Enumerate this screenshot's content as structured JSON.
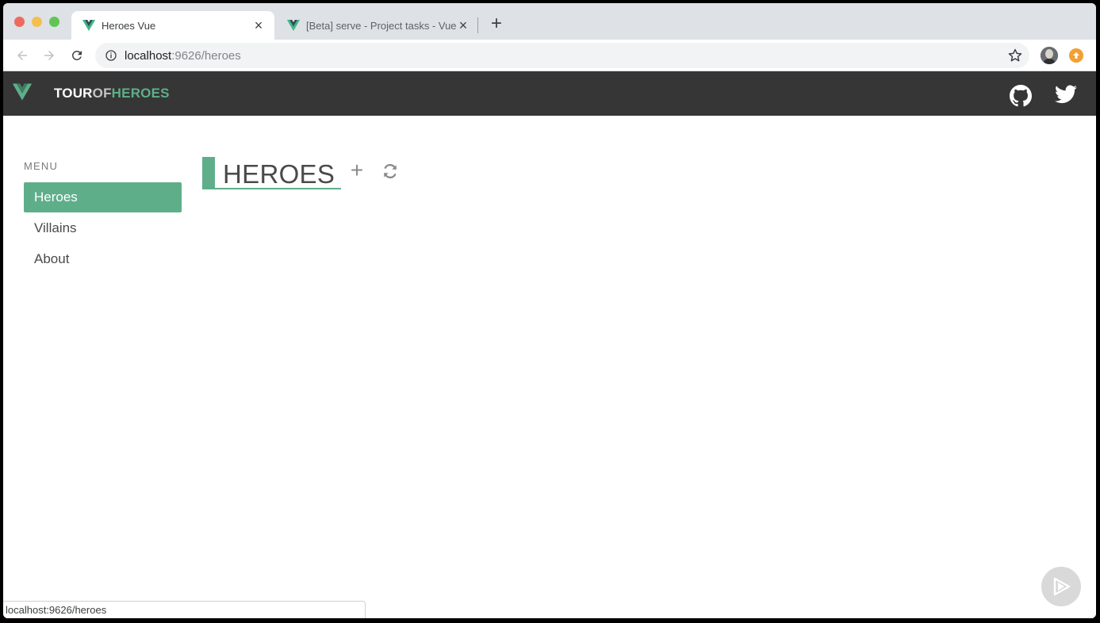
{
  "browser": {
    "tabs": [
      {
        "title": "Heroes Vue",
        "active": true
      },
      {
        "title": "[Beta] serve - Project tasks - Vue",
        "active": false
      }
    ],
    "new_tab_label": "+",
    "close_label": "×",
    "url": {
      "host": "localhost",
      "rest": ":9626/heroes"
    },
    "status_url": "localhost:9626/heroes"
  },
  "app": {
    "brand": {
      "part1": "TOUR",
      "part2": "OF",
      "part3": "HEROES"
    },
    "menu_label": "MENU",
    "menu_items": [
      {
        "label": "Heroes",
        "active": true
      },
      {
        "label": "Villains",
        "active": false
      },
      {
        "label": "About",
        "active": false
      }
    ],
    "page_title": "HEROES",
    "add_label": "+"
  },
  "colors": {
    "accent": "#5fae8a",
    "header_bg": "#363636",
    "text": "#4a4a4a"
  },
  "icons": [
    "vue-logo-icon",
    "github-icon",
    "twitter-icon",
    "refresh-icon",
    "info-icon",
    "star-icon",
    "play-icon"
  ]
}
